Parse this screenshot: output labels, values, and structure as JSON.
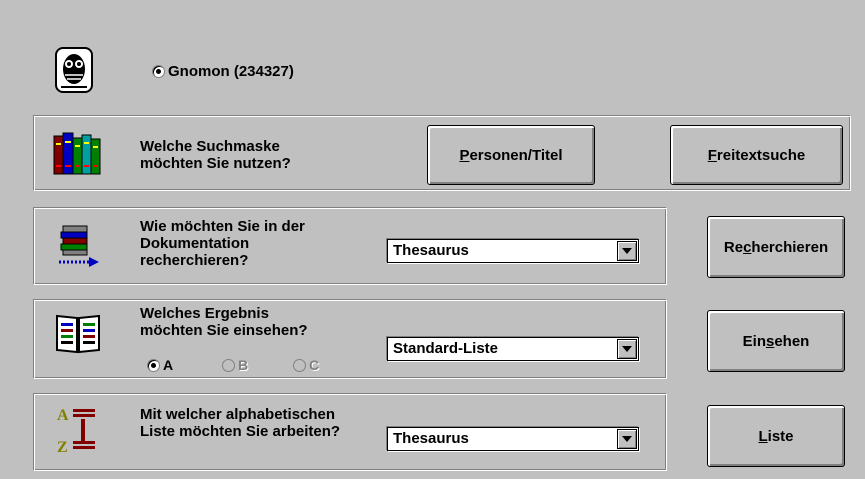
{
  "source": {
    "label": "Gnomon (234327)",
    "selected": true
  },
  "search_mask": {
    "question_line1": "Welche Suchmaske",
    "question_line2": "möchten Sie nutzen?",
    "btn_persons": {
      "underline": "P",
      "rest": "ersonen/Titel"
    },
    "btn_freetext": {
      "underline": "F",
      "rest": "reitextsuche"
    }
  },
  "research": {
    "line1": "Wie möchten Sie in der",
    "line2": "Dokumentation",
    "line3": "recherchieren?",
    "select_value": "Thesaurus",
    "button": {
      "pre": "Re",
      "underline": "c",
      "post": "herchieren"
    }
  },
  "results": {
    "line1": "Welches Ergebnis",
    "line2": "möchten Sie einsehen?",
    "radios": [
      {
        "label": "A",
        "selected": true,
        "enabled": true
      },
      {
        "label": "B",
        "selected": false,
        "enabled": false
      },
      {
        "label": "C",
        "selected": false,
        "enabled": false
      }
    ],
    "select_value": "Standard-Liste",
    "button": {
      "pre": "Ein",
      "underline": "s",
      "post": "ehen"
    }
  },
  "alpha_list": {
    "line1": "Mit welcher alphabetischen",
    "line2": "Liste möchten Sie arbeiten?",
    "select_value": "Thesaurus",
    "button": {
      "pre": "",
      "underline": "L",
      "post": "iste"
    }
  },
  "icons": {
    "logo": "owl-logo-icon",
    "search_mask": "books-icon",
    "research": "stacked-documents-arrow-icon",
    "results": "open-book-icon",
    "alpha_list": "a-to-z-list-icon"
  }
}
